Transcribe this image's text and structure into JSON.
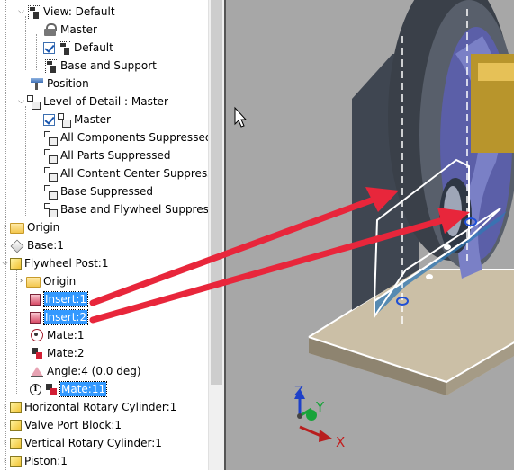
{
  "tree": {
    "view_default": "View: Default",
    "master_1": "Master",
    "default": "Default",
    "base_and_support": "Base and Support",
    "position": "Position",
    "level_of_detail": "Level of Detail : Master",
    "master_2": "Master",
    "all_components_suppressed": "All Components Suppressed",
    "all_parts_suppressed": "All Parts Suppressed",
    "all_content_center_suppressed": "All Content Center Suppresse",
    "base_suppressed": "Base Suppressed",
    "base_and_flywheel_suppressed": "Base and Flywheel Suppressed",
    "origin_1": "Origin",
    "base_1": "Base:1",
    "flywheel_post_1": "Flywheel Post:1",
    "origin_2": "Origin",
    "insert_1": "Insert:1",
    "insert_2": "Insert:2",
    "mate_1": "Mate:1",
    "mate_2": "Mate:2",
    "angle_4": "Angle:4 (0.0 deg)",
    "mate_11": "Mate:11",
    "horizontal_rotary_cylinder": "Horizontal Rotary Cylinder:1",
    "valve_port_block": "Valve Port Block:1",
    "vertical_rotary_cylinder": "Vertical Rotary Cylinder:1",
    "piston_1": "Piston:1"
  },
  "triad": {
    "z": "Z",
    "y": "Y",
    "x": "X"
  },
  "colors": {
    "selection": "#3399ff",
    "arrow": "#e8263b",
    "viewport_bg": "#a7a7a7"
  },
  "icons": {
    "view": "design-view-icon",
    "lock": "lock-icon",
    "lod": "level-of-detail-icon",
    "position": "positional-rep-icon",
    "folder": "origin-folder-icon",
    "part": "part-icon",
    "insert": "insert-constraint-icon",
    "mate": "mate-constraint-icon",
    "angle": "angle-constraint-icon",
    "info": "info-icon"
  }
}
